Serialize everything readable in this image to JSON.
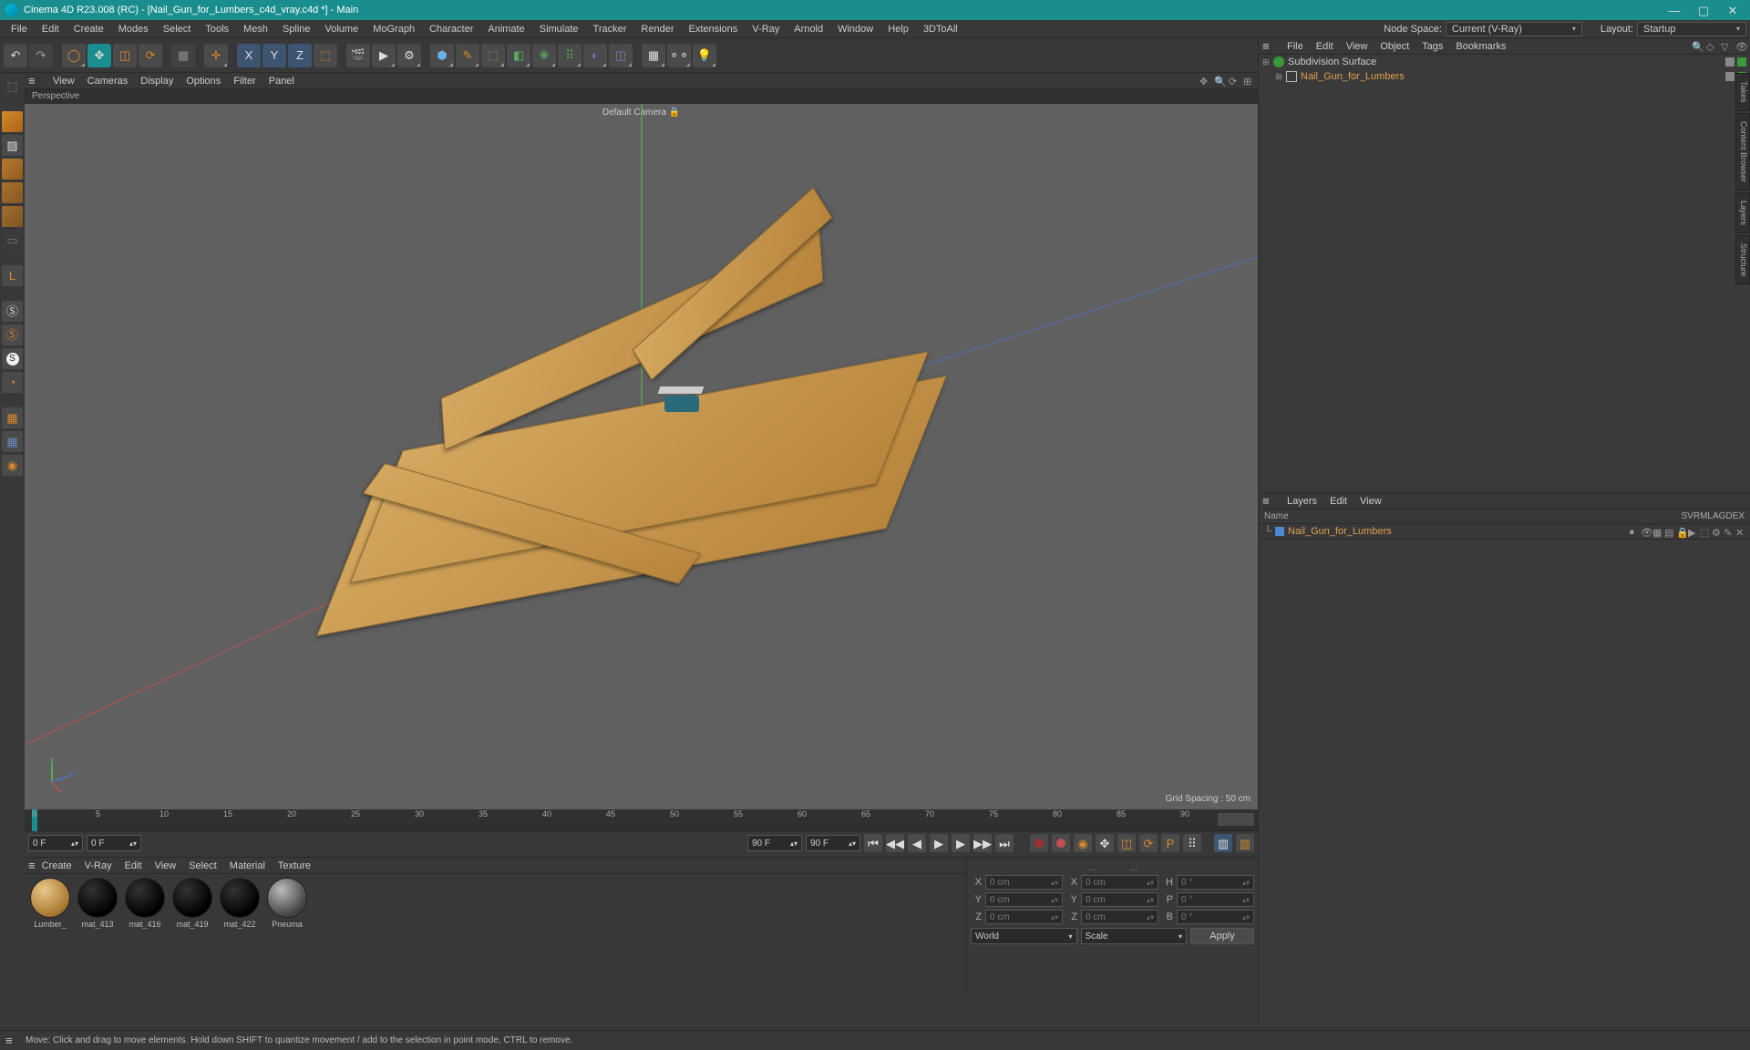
{
  "title": "Cinema 4D R23.008 (RC) - [Nail_Gun_for_Lumbers_c4d_vray.c4d *] - Main",
  "menubar": [
    "File",
    "Edit",
    "Create",
    "Modes",
    "Select",
    "Tools",
    "Mesh",
    "Spline",
    "Volume",
    "MoGraph",
    "Character",
    "Animate",
    "Simulate",
    "Tracker",
    "Render",
    "Extensions",
    "V-Ray",
    "Arnold",
    "Window",
    "Help",
    "3DToAll"
  ],
  "nodeSpaceLabel": "Node Space:",
  "nodeSpaceValue": "Current (V-Ray)",
  "layoutLabel": "Layout:",
  "layoutValue": "Startup",
  "vp": {
    "menu": [
      "View",
      "Cameras",
      "Display",
      "Options",
      "Filter",
      "Panel"
    ],
    "label": "Perspective",
    "camera": "Default Camera",
    "gridSpacing": "Grid Spacing : 50 cm"
  },
  "timeline": {
    "start": "0 F",
    "end": "90 F",
    "endMax": "90 F",
    "endMax2": "0 F",
    "ticks": [
      "0",
      "5",
      "10",
      "15",
      "20",
      "25",
      "30",
      "35",
      "40",
      "45",
      "50",
      "55",
      "60",
      "65",
      "70",
      "75",
      "80",
      "85",
      "90"
    ]
  },
  "materials": {
    "menu": [
      "Create",
      "V-Ray",
      "Edit",
      "View",
      "Select",
      "Material",
      "Texture"
    ],
    "items": [
      {
        "name": "Lumber_",
        "color": "radial-gradient(circle at 35% 30%, #e8c888, #a87830 70%, #604418)"
      },
      {
        "name": "mat_413",
        "color": "radial-gradient(circle at 35% 30%, #333, #000 70%)"
      },
      {
        "name": "mat_416",
        "color": "radial-gradient(circle at 35% 30%, #333, #000 70%)"
      },
      {
        "name": "mat_419",
        "color": "radial-gradient(circle at 35% 30%, #333, #000 70%)"
      },
      {
        "name": "mat_422",
        "color": "radial-gradient(circle at 35% 30%, #333, #000 70%)"
      },
      {
        "name": "Pneuma",
        "color": "radial-gradient(circle at 35% 30%, #bbb, #444 70%)"
      }
    ]
  },
  "coords": {
    "x": "0 cm",
    "y": "0 cm",
    "z": "0 cm",
    "sx": "0 cm",
    "sy": "0 cm",
    "sz": "0 cm",
    "h": "0 °",
    "p": "0 °",
    "b": "0 °",
    "mode": "World",
    "sizeMode": "Scale",
    "apply": "Apply"
  },
  "objmgr": {
    "menu": [
      "File",
      "Edit",
      "View",
      "Object",
      "Tags",
      "Bookmarks"
    ],
    "rows": [
      {
        "name": "Subdivision Surface",
        "indent": 0,
        "iconColor": "#3a9a3a",
        "sel": false,
        "tags": 2,
        "exp": "⊞"
      },
      {
        "name": "Nail_Gun_for_Lumbers",
        "indent": 1,
        "iconColor": "#bbb",
        "sel": true,
        "tags": 2,
        "exp": "⊞",
        "nullIcon": true
      }
    ]
  },
  "layers": {
    "menu": [
      "Layers",
      "Edit",
      "View"
    ],
    "cols": [
      "S",
      "V",
      "R",
      "M",
      "L",
      "A",
      "G",
      "D",
      "E",
      "X"
    ],
    "nameHdr": "Name",
    "rows": [
      {
        "name": "Nail_Gun_for_Lumbers",
        "color": "#4a8ad4"
      }
    ]
  },
  "rtabs": [
    "Takes",
    "Content Browser",
    "Layers",
    "Structure"
  ],
  "status": "Move: Click and drag to move elements. Hold down SHIFT to quantize movement / add to the selection in point mode, CTRL to remove.",
  "dotsLabel": "..."
}
